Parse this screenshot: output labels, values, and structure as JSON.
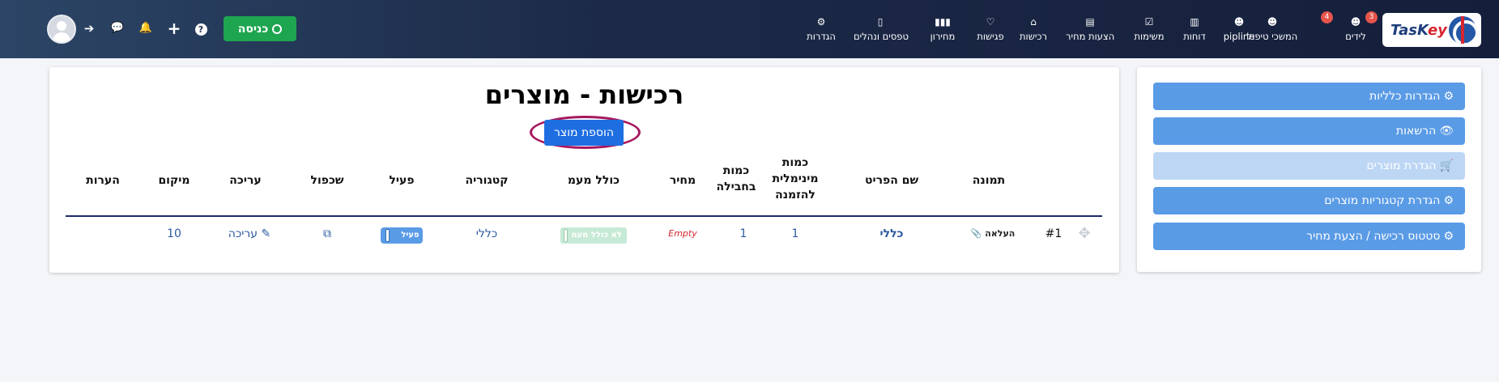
{
  "logo": {
    "text_main": "TasK",
    "text_accent": "ey"
  },
  "nav": [
    {
      "label": "לידים",
      "icon": "☻",
      "badge": "3"
    },
    {
      "label": "המשכי טיפול",
      "icon": "☻",
      "badge": "4"
    },
    {
      "label": "pipline",
      "icon": "☻",
      "badge": ""
    },
    {
      "label": "דוחות",
      "icon": "▥",
      "badge": ""
    },
    {
      "label": "משימות",
      "icon": "☑",
      "badge": ""
    },
    {
      "label": "הצעות מחיר",
      "icon": "▤",
      "badge": ""
    },
    {
      "label": "רכישות",
      "icon": "⌂",
      "badge": ""
    },
    {
      "label": "פגישות",
      "icon": "♡",
      "badge": ""
    },
    {
      "label": "מחירון",
      "icon": "▮▮▮",
      "badge": ""
    },
    {
      "label": "טפסים ונהלים",
      "icon": "▯",
      "badge": ""
    },
    {
      "label": "הגדרות",
      "icon": "⚙",
      "badge": ""
    }
  ],
  "toolbar": {
    "enter_label": "כניסה",
    "help_glyph": "?",
    "plus_glyph": "+",
    "bell_glyph": "🔔",
    "chat_glyph": "💬",
    "login_glyph": "➔"
  },
  "sidebar": {
    "buttons": [
      {
        "label": "הגדרות כלליות",
        "icon": "⚙",
        "disabled": false
      },
      {
        "label": "הרשאות",
        "icon": "👁",
        "disabled": false
      },
      {
        "label": "הגדרת מוצרים",
        "icon": "🛒",
        "disabled": true
      },
      {
        "label": "הגדרת קטגוריות מוצרים",
        "icon": "⚙",
        "disabled": false
      },
      {
        "label": "סטטוס רכישה / הצעת מחיר",
        "icon": "⚙",
        "disabled": false
      }
    ]
  },
  "main": {
    "title": "רכישות - מוצרים",
    "add_button": "הוספת מוצר",
    "columns": {
      "image": "תמונה",
      "name": "שם הפריט",
      "min_qty": "כמות מינימלית להזמנה",
      "pack_qty": "כמות בחבילה",
      "price": "מחיר",
      "vat": "כולל מעמ",
      "category": "קטגוריה",
      "active": "פעיל",
      "duplicate": "שכפול",
      "edit": "עריכה",
      "position": "מיקום",
      "notes": "הערות"
    },
    "rows": [
      {
        "num": "#1",
        "image": "העלאה",
        "name": "כללי",
        "min_qty": "1",
        "pack_qty": "1",
        "price": "Empty",
        "vat": "לא כולל מעמ",
        "category": "כללי",
        "active": "פעיל",
        "edit": "עריכה",
        "position": "10",
        "notes": ""
      }
    ]
  }
}
